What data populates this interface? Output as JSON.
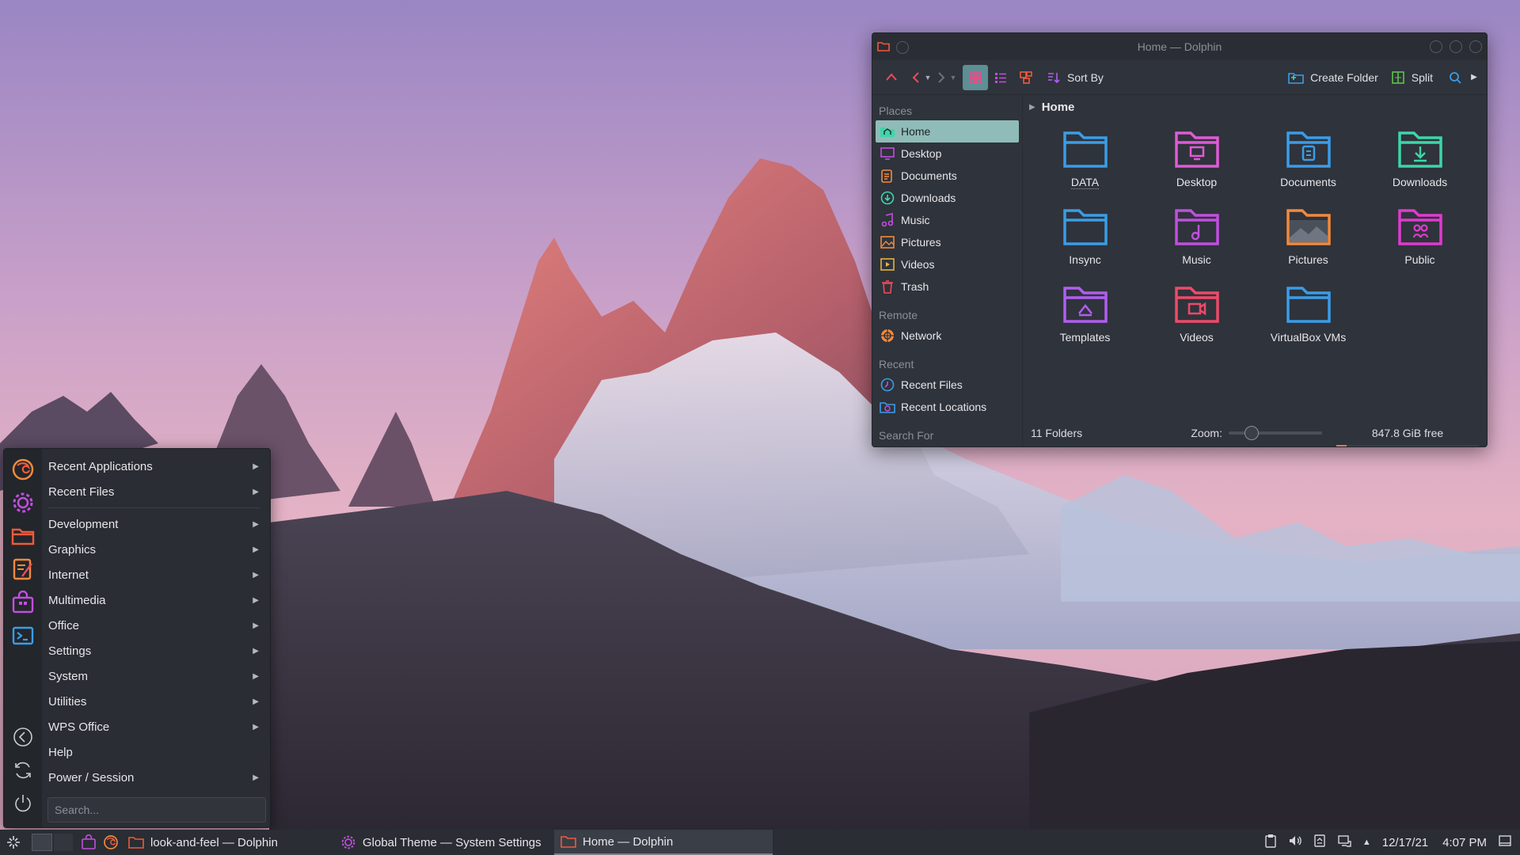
{
  "colors": {
    "accent": "#8fbcb8",
    "panel_bg": "#2a2d33",
    "window_bg": "#2f333b",
    "folder_blue": "#3a9de8",
    "folder_pink": "#e05ad7",
    "folder_green": "#3dd6a8",
    "folder_orange": "#f28a3d"
  },
  "dolphin": {
    "title": "Home — Dolphin",
    "toolbar": {
      "up_icon": "go-up-icon",
      "back_icon": "go-back-icon",
      "forward_icon": "go-forward-icon",
      "icons_view_icon": "view-icons-icon",
      "details_view_icon": "view-details-icon",
      "preview_icon": "view-preview-icon",
      "sort_label": "Sort By",
      "create_folder_label": "Create Folder",
      "split_label": "Split",
      "search_icon": "search-icon",
      "more_icon": "overflow-icon"
    },
    "places": {
      "title": "Places",
      "items": [
        {
          "label": "Home",
          "icon": "home-folder-icon",
          "selected": true
        },
        {
          "label": "Desktop",
          "icon": "desktop-icon"
        },
        {
          "label": "Documents",
          "icon": "documents-icon"
        },
        {
          "label": "Downloads",
          "icon": "downloads-icon"
        },
        {
          "label": "Music",
          "icon": "music-icon"
        },
        {
          "label": "Pictures",
          "icon": "pictures-icon"
        },
        {
          "label": "Videos",
          "icon": "videos-icon"
        },
        {
          "label": "Trash",
          "icon": "trash-icon"
        }
      ]
    },
    "remote": {
      "title": "Remote",
      "items": [
        {
          "label": "Network",
          "icon": "network-icon"
        }
      ]
    },
    "recent": {
      "title": "Recent",
      "items": [
        {
          "label": "Recent Files",
          "icon": "recent-files-icon"
        },
        {
          "label": "Recent Locations",
          "icon": "recent-locations-icon"
        }
      ]
    },
    "search_for_title": "Search For",
    "breadcrumb": "Home",
    "folders": [
      {
        "name": "DATA",
        "icon": "folder-blue-icon"
      },
      {
        "name": "Desktop",
        "icon": "folder-desktop-icon"
      },
      {
        "name": "Documents",
        "icon": "folder-documents-icon"
      },
      {
        "name": "Downloads",
        "icon": "folder-downloads-icon"
      },
      {
        "name": "Insync",
        "icon": "folder-blue-icon"
      },
      {
        "name": "Music",
        "icon": "folder-music-icon"
      },
      {
        "name": "Pictures",
        "icon": "folder-pictures-icon"
      },
      {
        "name": "Public",
        "icon": "folder-public-icon"
      },
      {
        "name": "Templates",
        "icon": "folder-templates-icon"
      },
      {
        "name": "Videos",
        "icon": "folder-videos-icon"
      },
      {
        "name": "VirtualBox VMs",
        "icon": "folder-blue-icon"
      }
    ],
    "status": {
      "count": "11 Folders",
      "zoom_label": "Zoom:",
      "free_space": "847.8 GiB free",
      "zoom_level": 0.2,
      "used_fraction": 0.07
    }
  },
  "launcher": {
    "favorites": [
      "firefox-icon",
      "settings-icon",
      "file-manager-icon",
      "text-editor-icon",
      "software-store-icon",
      "terminal-icon"
    ],
    "session_icons": [
      "back-icon",
      "refresh-icon",
      "power-icon"
    ],
    "items": [
      {
        "label": "Recent Applications",
        "submenu": true
      },
      {
        "label": "Recent Files",
        "submenu": true
      },
      {
        "label": "Development",
        "submenu": true
      },
      {
        "label": "Graphics",
        "submenu": true
      },
      {
        "label": "Internet",
        "submenu": true
      },
      {
        "label": "Multimedia",
        "submenu": true
      },
      {
        "label": "Office",
        "submenu": true
      },
      {
        "label": "Settings",
        "submenu": true
      },
      {
        "label": "System",
        "submenu": true
      },
      {
        "label": "Utilities",
        "submenu": true
      },
      {
        "label": "WPS Office",
        "submenu": true
      },
      {
        "label": "Help",
        "submenu": false
      },
      {
        "label": "Power / Session",
        "submenu": true
      }
    ],
    "search_placeholder": "Search..."
  },
  "taskbar": {
    "tasks": [
      {
        "label": "look-and-feel — Dolphin",
        "icon": "folder-icon"
      },
      {
        "label": "Global Theme  — System Settings",
        "icon": "settings-icon"
      },
      {
        "label": "Home — Dolphin",
        "icon": "folder-icon",
        "active": true
      }
    ],
    "date": "12/17/21",
    "time": "4:07 PM"
  }
}
